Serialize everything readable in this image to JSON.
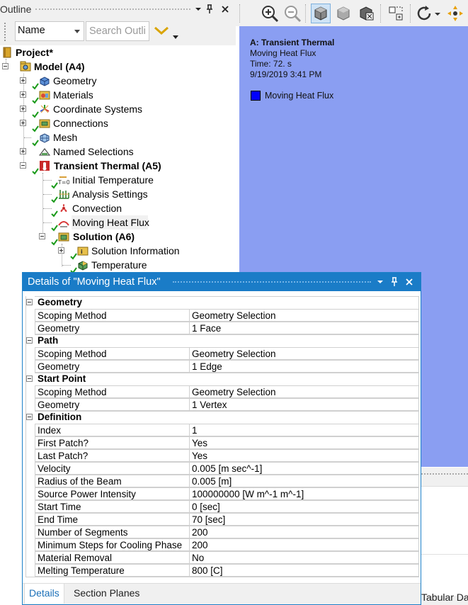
{
  "outline": {
    "title": "Outline",
    "header_icons": {
      "dropdown": "chevron-down-icon",
      "pin": "pin-icon",
      "close": "close-icon"
    },
    "name_select_value": "Name",
    "search_placeholder": "Search Outline"
  },
  "tree": {
    "project": "Project*",
    "model": "Model (A4)",
    "geometry": "Geometry",
    "materials": "Materials",
    "coordinate_systems": "Coordinate Systems",
    "connections": "Connections",
    "mesh": "Mesh",
    "named_selections": "Named Selections",
    "transient_thermal": "Transient Thermal (A5)",
    "initial_temperature": "Initial Temperature",
    "analysis_settings": "Analysis Settings",
    "convection": "Convection",
    "moving_heat_flux": "Moving Heat Flux",
    "solution": "Solution (A6)",
    "solution_information": "Solution Information",
    "temperature": "Temperature"
  },
  "graphics": {
    "title": "A: Transient Thermal",
    "subtitle": "Moving Heat Flux",
    "time": "Time: 72. s",
    "date": "9/19/2019 3:41 PM",
    "legend_label": "Moving Heat Flux",
    "legend_color": "#0000ff",
    "background_color": "#8a9ef2",
    "tabular_tab": "Tabular Data"
  },
  "details": {
    "title": "Details of \"Moving Heat Flux\"",
    "title_bar_color": "#1a7cc7",
    "sections": [
      {
        "name": "Geometry",
        "rows": [
          [
            "Scoping Method",
            "Geometry Selection"
          ],
          [
            "Geometry",
            "1 Face"
          ]
        ]
      },
      {
        "name": "Path",
        "rows": [
          [
            "Scoping Method",
            "Geometry Selection"
          ],
          [
            "Geometry",
            "1 Edge"
          ]
        ]
      },
      {
        "name": "Start Point",
        "rows": [
          [
            "Scoping Method",
            "Geometry Selection"
          ],
          [
            "Geometry",
            "1 Vertex"
          ]
        ]
      },
      {
        "name": "Definition",
        "rows": [
          [
            "Index",
            "1"
          ],
          [
            "First Patch?",
            "Yes"
          ],
          [
            "Last Patch?",
            "Yes"
          ],
          [
            "Velocity",
            "0.005 [m sec^-1]"
          ],
          [
            "Radius of the Beam",
            "0.005 [m]"
          ],
          [
            "Source Power Intensity",
            "100000000 [W m^-1 m^-1]"
          ],
          [
            "Start Time",
            "0 [sec]"
          ],
          [
            "End Time",
            "70 [sec]"
          ],
          [
            "Number of Segments",
            "200"
          ],
          [
            "Minimum Steps for Cooling Phase",
            "200"
          ],
          [
            "Material Removal",
            "No"
          ],
          [
            "Melting Temperature",
            "800 [C]"
          ]
        ]
      }
    ],
    "tabs": [
      "Details",
      "Section Planes"
    ]
  }
}
